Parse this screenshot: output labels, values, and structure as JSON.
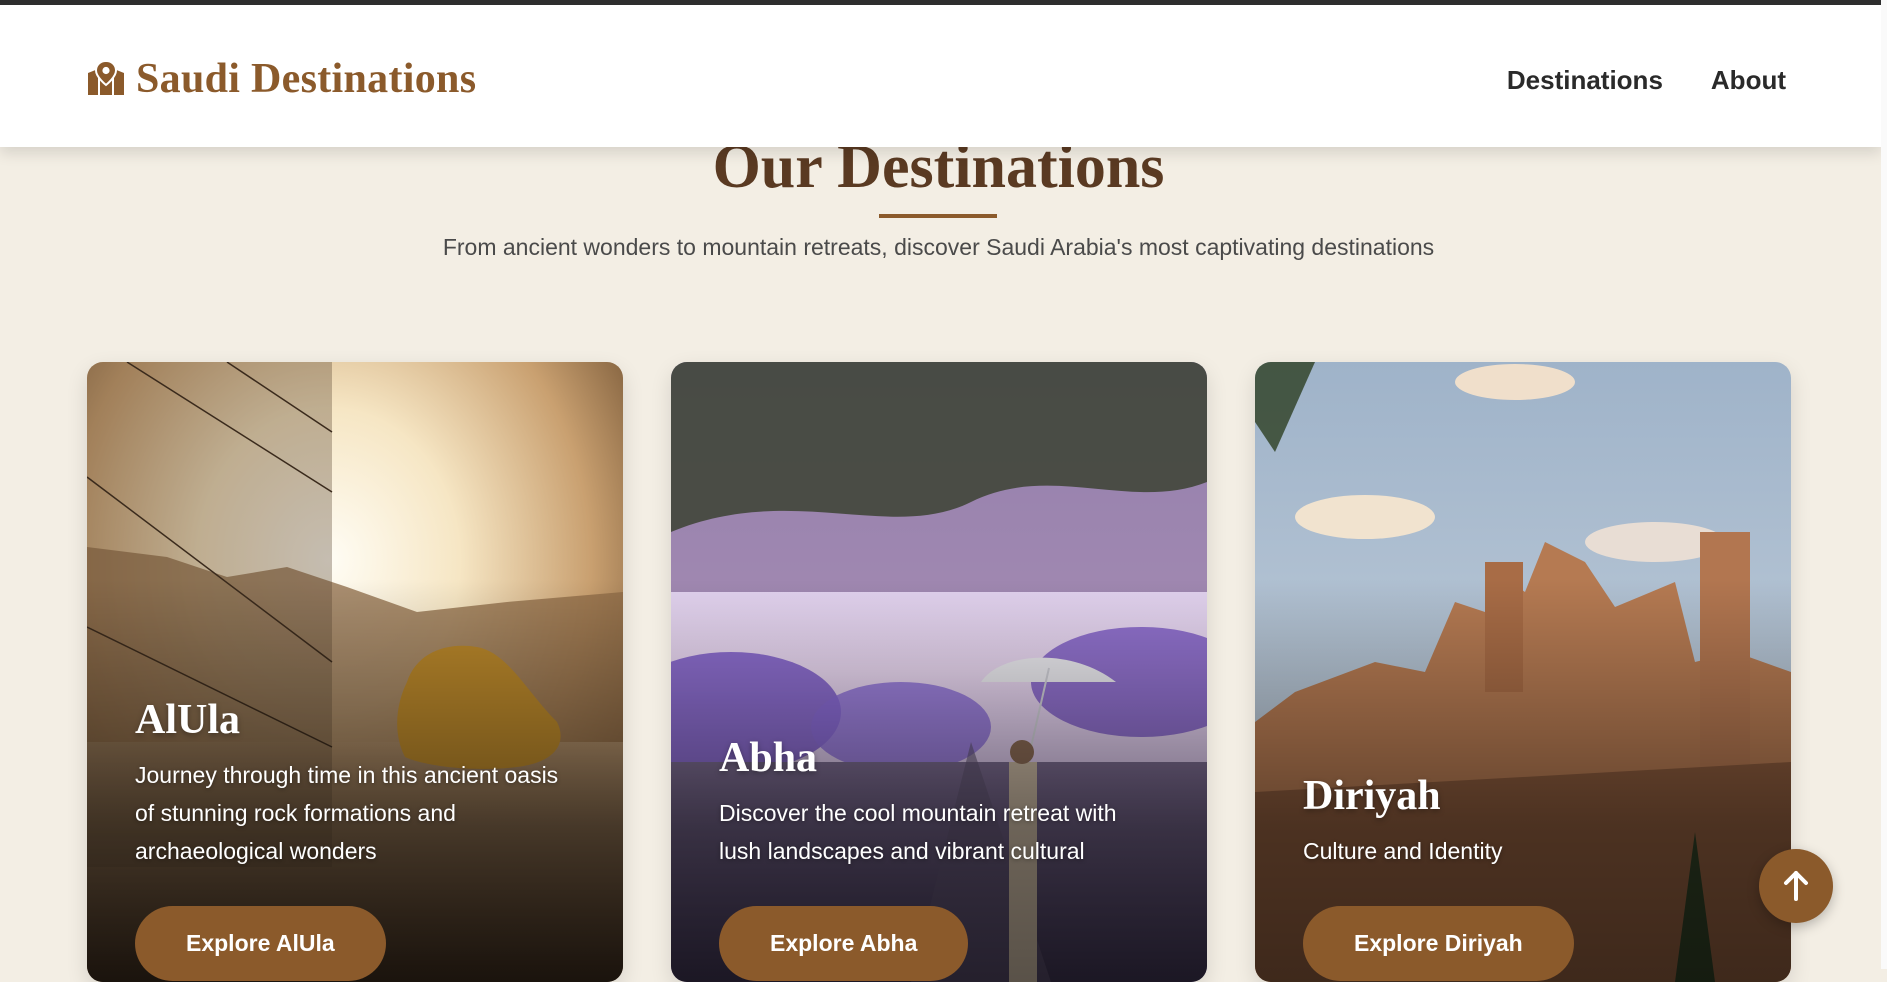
{
  "brand": {
    "name": "Saudi Destinations",
    "icon": "map-location-icon"
  },
  "nav": {
    "items": [
      "Destinations",
      "About"
    ]
  },
  "section": {
    "title": "Our Destinations",
    "subtitle": "From ancient wonders to mountain retreats, discover Saudi Arabia's most captivating destinations"
  },
  "cards": [
    {
      "name": "AlUla",
      "description": "Journey through time in this ancient oasis of stunning rock formations and archaeological wonders",
      "button": "Explore AlUla"
    },
    {
      "name": "Abha",
      "description": "Discover the cool mountain retreat with lush landscapes and vibrant cultural",
      "button": "Explore Abha"
    },
    {
      "name": "Diriyah",
      "description": "Culture and Identity",
      "button": "Explore Diriyah"
    }
  ],
  "back_to_top": {
    "icon": "arrow-up-icon"
  },
  "colors": {
    "accent": "#8b5a2b",
    "title": "#5a3a22",
    "background": "#f3eee4"
  }
}
